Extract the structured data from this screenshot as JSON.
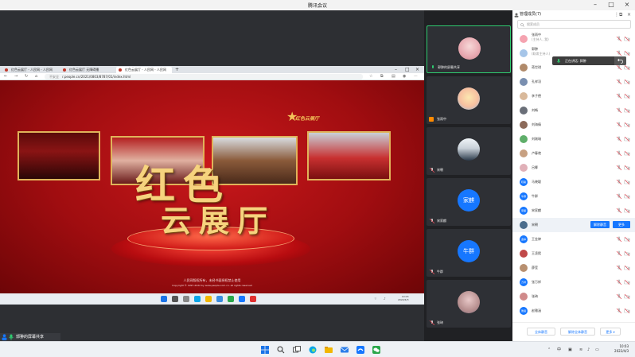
{
  "window": {
    "title": "腾讯会议"
  },
  "browser": {
    "tabs": [
      {
        "label": "红色云展厅 - 人民网 - 人民网"
      },
      {
        "label": "红色云展厅 无障碍播"
      },
      {
        "label": "红色云展厅 - 人民网 - 人民网"
      }
    ],
    "address": {
      "not_secure": "不安全",
      "url": "r.people.cn/2021/0803/8787/01/index.html"
    }
  },
  "webpage": {
    "heading_line1": "红色",
    "heading_line2": "云展厅",
    "logo_text_1": "红色",
    "logo_text_2": "云展厅",
    "footer_line1": "人民网版权所有，未经书面授权禁止使用",
    "footer_line2": "Copyright © 1997-2022 by www.people.com.cn. all rights reserved"
  },
  "inner_clock": {
    "time": "10:03",
    "date": "2022/4/3"
  },
  "presenter": {
    "label": "郭翀的屏幕共享"
  },
  "tiles": [
    {
      "name": "郭翀的屏幕共享",
      "avatar": "photo-avatar-pink"
    },
    {
      "name": "张雨中",
      "avatar": "cartoon-avatar"
    },
    {
      "name": "宋朝",
      "avatar": "mountain-avatar"
    },
    {
      "name": "宋家麒",
      "avatar_text": "家麒"
    },
    {
      "name": "牛群",
      "avatar_text": "牛群"
    },
    {
      "name": "张琦",
      "avatar": "photo-avatar-blur"
    }
  ],
  "panel": {
    "title": "管理成员(7)",
    "search_placeholder": "搜索成员",
    "toast": "正在讲话: 郭翀",
    "members": [
      {
        "name": "张雨中",
        "sub": "(主持人, 我)",
        "avatar_color": "#f5a3b0"
      },
      {
        "name": "郭翀",
        "sub": "(联席主持人)",
        "avatar_color": "#a6c5e8"
      },
      {
        "name": "蒋世琪",
        "sub": "",
        "avatar_color": "#b08a6a"
      },
      {
        "name": "孔祥羽",
        "sub": "",
        "avatar_color": "#7a8fb0"
      },
      {
        "name": "李子德",
        "sub": "",
        "avatar_color": "#d9b99b"
      },
      {
        "name": "刘畅",
        "sub": "",
        "avatar_color": "#6a6f78"
      },
      {
        "name": "刘海倩",
        "sub": "",
        "avatar_color": "#8c6a5a"
      },
      {
        "name": "刘刚瑞",
        "sub": "",
        "avatar_color": "#5fae6a"
      },
      {
        "name": "卢春艳",
        "sub": "",
        "avatar_color": "#c7a081"
      },
      {
        "name": "吕椰",
        "sub": "",
        "avatar_color": "#e0b0b8"
      },
      {
        "name": "马晓聪",
        "sub": "",
        "avatar_color": "#1677ff",
        "avatar_text": "晓聪"
      },
      {
        "name": "牛群",
        "sub": "",
        "avatar_color": "#1677ff",
        "avatar_text": "牛群"
      },
      {
        "name": "宋家麒",
        "sub": "",
        "avatar_color": "#1677ff",
        "avatar_text": "家麒"
      },
      {
        "name": "宋朝",
        "sub": "",
        "avatar_color": "#4a6c8c",
        "hover": true,
        "unmute_label": "解除静音",
        "more_label": "更多"
      },
      {
        "name": "王金婷",
        "sub": "",
        "avatar_color": "#1677ff",
        "avatar_text": "金婷"
      },
      {
        "name": "王凌熙",
        "sub": "",
        "avatar_color": "#c04848"
      },
      {
        "name": "薛莹",
        "sub": "",
        "avatar_color": "#b89070"
      },
      {
        "name": "张万祥",
        "sub": "",
        "avatar_color": "#1677ff",
        "avatar_text": "万祥"
      },
      {
        "name": "张琦",
        "sub": "",
        "avatar_color": "#d08a8a"
      },
      {
        "name": "赵雅涵",
        "sub": "",
        "avatar_color": "#1677ff",
        "avatar_text": "雅涵"
      }
    ],
    "footer": {
      "mute_all": "全体静音",
      "unmute_all": "解除全体静音",
      "more": "更多 ▾"
    }
  },
  "taskbar": {
    "time": "10:03",
    "date": "2022/4/3",
    "lang": "中"
  },
  "colors": {
    "accent": "#1677ff",
    "active_speaker": "#2fcb70",
    "muted": "#e34d59"
  }
}
